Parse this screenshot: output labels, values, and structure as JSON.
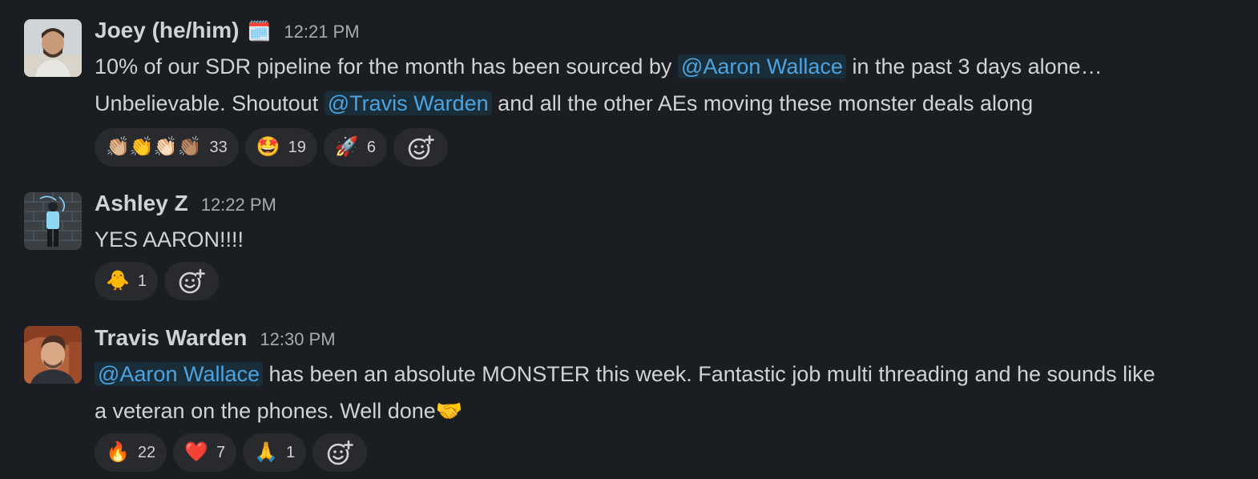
{
  "messages": [
    {
      "author": "Joey (he/him)",
      "status_emoji": "🗓️",
      "time": "12:21 PM",
      "line1_before": "10% of our SDR pipeline for the month has been sourced by ",
      "mention1": "@Aaron Wallace",
      "line1_after": " in the past 3 days alone…",
      "line2_before": "Unbelievable. Shoutout ",
      "mention2": "@Travis Warden",
      "line2_after": " and all the other AEs moving these monster deals along",
      "reactions": [
        {
          "emoji": "👏🏼👏👏🏻👏🏽",
          "count": "33"
        },
        {
          "emoji": "🤩",
          "count": "19"
        },
        {
          "emoji": "🚀",
          "count": "6"
        }
      ]
    },
    {
      "author": "Ashley Z",
      "time": "12:22 PM",
      "text": "YES AARON!!!!",
      "reactions": [
        {
          "emoji": "🐥",
          "count": "1"
        }
      ]
    },
    {
      "author": "Travis Warden",
      "time": "12:30 PM",
      "mention1": "@Aaron Wallace",
      "line1_after": " has been an absolute MONSTER this week. Fantastic job multi threading and he sounds like",
      "line2": "a veteran on the phones. Well done🤝",
      "reactions": [
        {
          "emoji": "🔥",
          "count": "22"
        },
        {
          "emoji": "❤️",
          "count": "7"
        },
        {
          "emoji": "🙏",
          "count": "1"
        }
      ]
    }
  ],
  "icons": {
    "add_reaction": "add-reaction-icon"
  },
  "colors": {
    "background": "#1a1d21",
    "mention_text": "#4da3e0",
    "pill_background": "#282a2e"
  }
}
